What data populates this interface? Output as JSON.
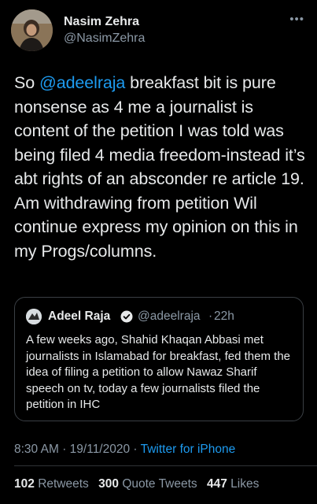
{
  "author": {
    "name": "Nasim Zehra",
    "handle": "@NasimZehra"
  },
  "tweet": {
    "mention": "@adeelraja",
    "text_after_mention": " breakfast bit is pure nonsense as 4 me a journalist is content of the petition I was told was being filed 4 media freedom-instead it’s abt rights of an absconder re article 19. Am withdrawing from petition Wil continue express my opinion on this in my Progs/columns.",
    "text_before_mention": "So "
  },
  "quoted_tweet": {
    "name": "Adeel Raja",
    "handle": "@adeelraja",
    "separator": "·",
    "time": "22h",
    "text": "A few weeks ago, Shahid Khaqan Abbasi met journalists in Islamabad for breakfast, fed them the idea of filing a petition to allow Nawaz Sharif speech on tv, today a few journalists filed the petition in IHC"
  },
  "meta": {
    "time": "8:30 AM",
    "date": "19/11/2020",
    "separator": "·",
    "source": "Twitter for iPhone"
  },
  "stats": {
    "retweets_count": "102",
    "retweets_label": "Retweets",
    "quotes_count": "300",
    "quotes_label": "Quote Tweets",
    "likes_count": "447",
    "likes_label": "Likes"
  },
  "colors": {
    "background": "#000000",
    "text": "#e7e9ea",
    "secondary": "#8b98a5",
    "link": "#1d9bf0"
  }
}
